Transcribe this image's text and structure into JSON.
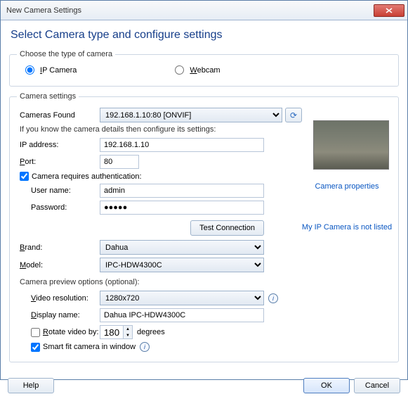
{
  "window": {
    "title": "New Camera Settings"
  },
  "heading": "Select Camera type and configure settings",
  "typeGroup": {
    "legend": "Choose the type of camera",
    "ip": "IP Camera",
    "webcam": "Webcam"
  },
  "settingsGroup": {
    "legend": "Camera settings",
    "camerasFoundLabel": "Cameras Found",
    "camerasFoundValue": "192.168.1.10:80 [ONVIF]",
    "note": "If you know the camera details then configure its settings:",
    "ipLabel": "IP address:",
    "ipValue": "192.168.1.10",
    "portLabel": "Port:",
    "portValue": "80",
    "authLabel": "Camera requires authentication:",
    "userLabel": "User name:",
    "userValue": "admin",
    "passwordLabel": "Password:",
    "passwordDots": "●●●●●",
    "testBtn": "Test Connection",
    "brandLabel": "Brand:",
    "brandValue": "Dahua",
    "modelLabel": "Model:",
    "modelValue": "IPC-HDW4300C",
    "previewHeading": "Camera preview options (optional):",
    "videoLabel": "Video resolution:",
    "videoValue": "1280x720",
    "displayLabel": "Display name:",
    "displayValue": "Dahua IPC-HDW4300C",
    "rotateLabel": "Rotate video by:",
    "rotateValue": "180",
    "rotateUnits": "degrees",
    "smartFitLabel": "Smart fit camera in window",
    "propsLink": "Camera properties",
    "notListedLink": "My IP Camera is not listed"
  },
  "footer": {
    "help": "Help",
    "ok": "OK",
    "cancel": "Cancel"
  }
}
